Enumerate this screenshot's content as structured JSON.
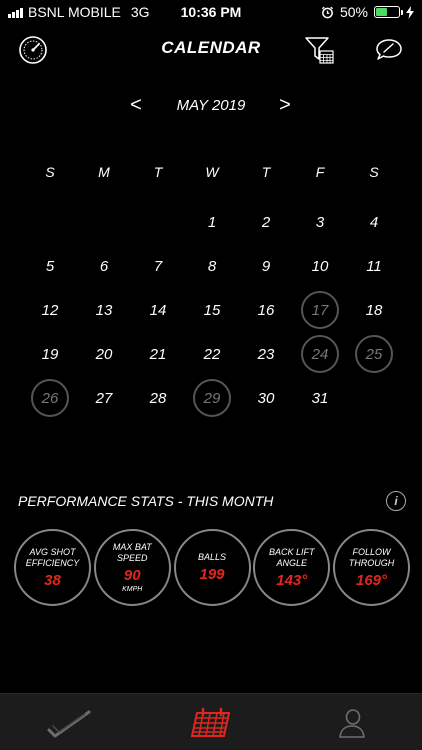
{
  "status_bar": {
    "carrier": "BSNL MOBILE",
    "network": "3G",
    "time": "10:36 PM",
    "battery": "50%",
    "battery_level": 0.5,
    "battery_color": "#4cd964"
  },
  "header": {
    "title": "CALENDAR",
    "icons": [
      "gauge-icon",
      "filter-calendar-icon",
      "chat-icon"
    ]
  },
  "calendar": {
    "month": "MAY 2019",
    "prev": "<",
    "next": ">",
    "weekdays": [
      "S",
      "M",
      "T",
      "W",
      "T",
      "F",
      "S"
    ],
    "days": [
      {
        "label": "",
        "marked": false
      },
      {
        "label": "",
        "marked": false
      },
      {
        "label": "",
        "marked": false
      },
      {
        "label": "1",
        "marked": false
      },
      {
        "label": "2",
        "marked": false
      },
      {
        "label": "3",
        "marked": false
      },
      {
        "label": "4",
        "marked": false
      },
      {
        "label": "5",
        "marked": false
      },
      {
        "label": "6",
        "marked": false
      },
      {
        "label": "7",
        "marked": false
      },
      {
        "label": "8",
        "marked": false
      },
      {
        "label": "9",
        "marked": false
      },
      {
        "label": "10",
        "marked": false
      },
      {
        "label": "11",
        "marked": false
      },
      {
        "label": "12",
        "marked": false
      },
      {
        "label": "13",
        "marked": false
      },
      {
        "label": "14",
        "marked": false
      },
      {
        "label": "15",
        "marked": false
      },
      {
        "label": "16",
        "marked": false
      },
      {
        "label": "17",
        "marked": true
      },
      {
        "label": "18",
        "marked": false
      },
      {
        "label": "19",
        "marked": false
      },
      {
        "label": "20",
        "marked": false
      },
      {
        "label": "21",
        "marked": false
      },
      {
        "label": "22",
        "marked": false
      },
      {
        "label": "23",
        "marked": false
      },
      {
        "label": "24",
        "marked": true
      },
      {
        "label": "25",
        "marked": true
      },
      {
        "label": "26",
        "marked": true
      },
      {
        "label": "27",
        "marked": false
      },
      {
        "label": "28",
        "marked": false
      },
      {
        "label": "29",
        "marked": true
      },
      {
        "label": "30",
        "marked": false
      },
      {
        "label": "31",
        "marked": false
      }
    ]
  },
  "performance": {
    "title": "PERFORMANCE STATS - THIS MONTH",
    "info": "i",
    "accent_color": "#e0261e",
    "stats": [
      {
        "label_lines": [
          "AVG SHOT",
          "EFFICIENCY"
        ],
        "value": "38",
        "unit": ""
      },
      {
        "label_lines": [
          "MAX BAT",
          "SPEED"
        ],
        "value": "90",
        "unit": "KMPH"
      },
      {
        "label_lines": [
          "BALLS"
        ],
        "value": "199",
        "unit": ""
      },
      {
        "label_lines": [
          "BACK LIFT",
          "ANGLE"
        ],
        "value": "143°",
        "unit": ""
      },
      {
        "label_lines": [
          "FOLLOW",
          "THROUGH"
        ],
        "value": "169°",
        "unit": ""
      }
    ]
  },
  "tabbar": {
    "tabs": [
      {
        "icon": "bat-swing-icon",
        "active": false
      },
      {
        "icon": "calendar-icon",
        "active": true
      },
      {
        "icon": "profile-icon",
        "active": false
      }
    ]
  }
}
